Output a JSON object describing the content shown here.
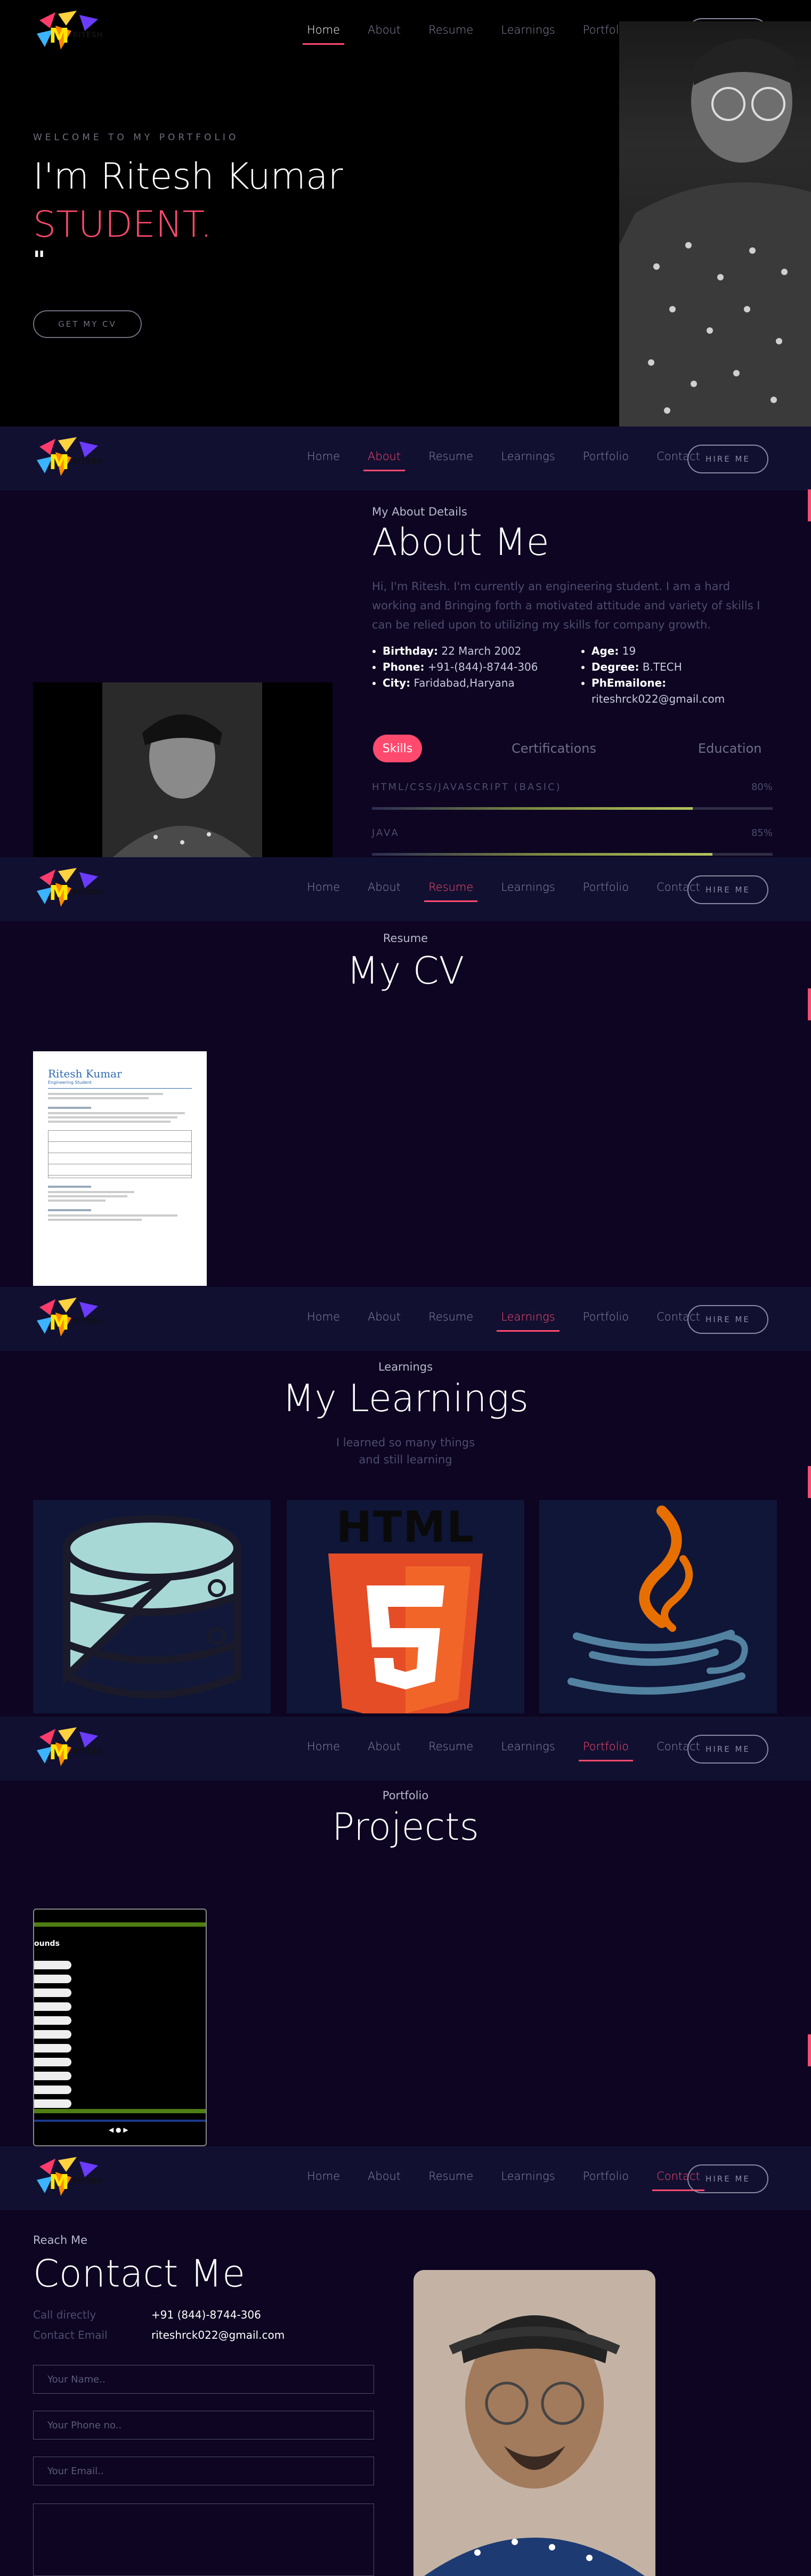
{
  "nav": {
    "items": [
      "Home",
      "About",
      "Resume",
      "Learnings",
      "Portfolio",
      "Contact"
    ],
    "hire_label": "HIRE ME"
  },
  "hero": {
    "welcome": "WELCOME TO MY PORTFOLIO",
    "name": "I'm Ritesh Kumar",
    "role": "STUDENT.",
    "quote_mark": "\"",
    "cv_button": "GET MY CV"
  },
  "about": {
    "kicker": "My About Details",
    "title": "About Me",
    "intro": "Hi, I'm Ritesh. I'm currently an engineering student. I am a hard working and Bringing forth a motivated attitude and variety of skills I can be relied upon to utilizing my skills for company growth.",
    "details_left": [
      {
        "label": "Birthday:",
        "value": "22 March 2002"
      },
      {
        "label": "Phone:",
        "value": "+91-(844)-8744-306"
      },
      {
        "label": "City:",
        "value": "Faridabad,Haryana"
      }
    ],
    "details_right": [
      {
        "label": "Age:",
        "value": "19"
      },
      {
        "label": "Degree:",
        "value": "B.TECH"
      },
      {
        "label": "PhEmailone:",
        "value": "riteshrck022@gmail.com"
      }
    ],
    "tabs": [
      "Skills",
      "Certifications",
      "Education"
    ],
    "skills": [
      {
        "name": "HTML/CSS/JAVASCRIPT (BASIC)",
        "percent_label": "80%",
        "percent": 80
      },
      {
        "name": "JAVA",
        "percent_label": "85%",
        "percent": 85
      }
    ]
  },
  "resume": {
    "kicker": "Resume",
    "title": "My CV",
    "cv_doc": {
      "name": "Ritesh Kumar",
      "headline": "Engineering Student"
    }
  },
  "learnings": {
    "kicker": "Learnings",
    "title": "My Learnings",
    "subtitle_line1": "I learned so many things",
    "subtitle_line2": "and still learning",
    "cards": [
      "database",
      "html5",
      "java"
    ],
    "html_label": "HTML",
    "html_digit": "5"
  },
  "portfolio": {
    "kicker": "Portfolio",
    "title": "Projects",
    "project_heading": "ounds"
  },
  "contact": {
    "kicker": "Reach Me",
    "title": "Contact Me",
    "call_label": "Call directly",
    "call_value": "+91 (844)-8744-306",
    "email_label": "Contact Email",
    "email_value": "riteshrck022@gmail.com",
    "placeholders": [
      "Your Name..",
      "Your Phone no..",
      "Your Email.."
    ]
  },
  "colors": {
    "accent": "#ff4a6e",
    "background": "#0d0521",
    "navbar": "#111031"
  }
}
